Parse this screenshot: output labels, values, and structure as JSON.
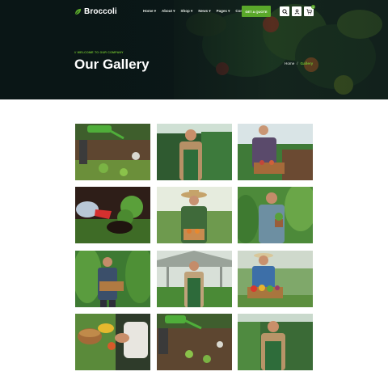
{
  "brand": {
    "name": "Broccoli",
    "accent": "#5aa82a"
  },
  "nav": [
    "Home",
    "About",
    "Shop",
    "News",
    "Pages",
    "Contact"
  ],
  "header": {
    "cta_label": "GET A QUOTE",
    "cart_count": "0",
    "icons": [
      "search-icon",
      "user-icon",
      "cart-icon"
    ]
  },
  "hero": {
    "eyebrow": "// WELCOME TO OUR COMPANY",
    "title": "Our Gallery"
  },
  "breadcrumb": {
    "home": "Home",
    "separator": "/",
    "current": "Gallery"
  },
  "gallery": {
    "items": [
      "watering-seedlings",
      "farmer-greenhouse",
      "farmer-crate",
      "planting-gloves",
      "farmer-hat-crate",
      "farmer-sapling",
      "farmer-crate-field",
      "farmer-greenhouse-2",
      "farmer-vegetables",
      "harvest-basket",
      "watering-plants",
      "farmer-greenhouse-3"
    ]
  }
}
